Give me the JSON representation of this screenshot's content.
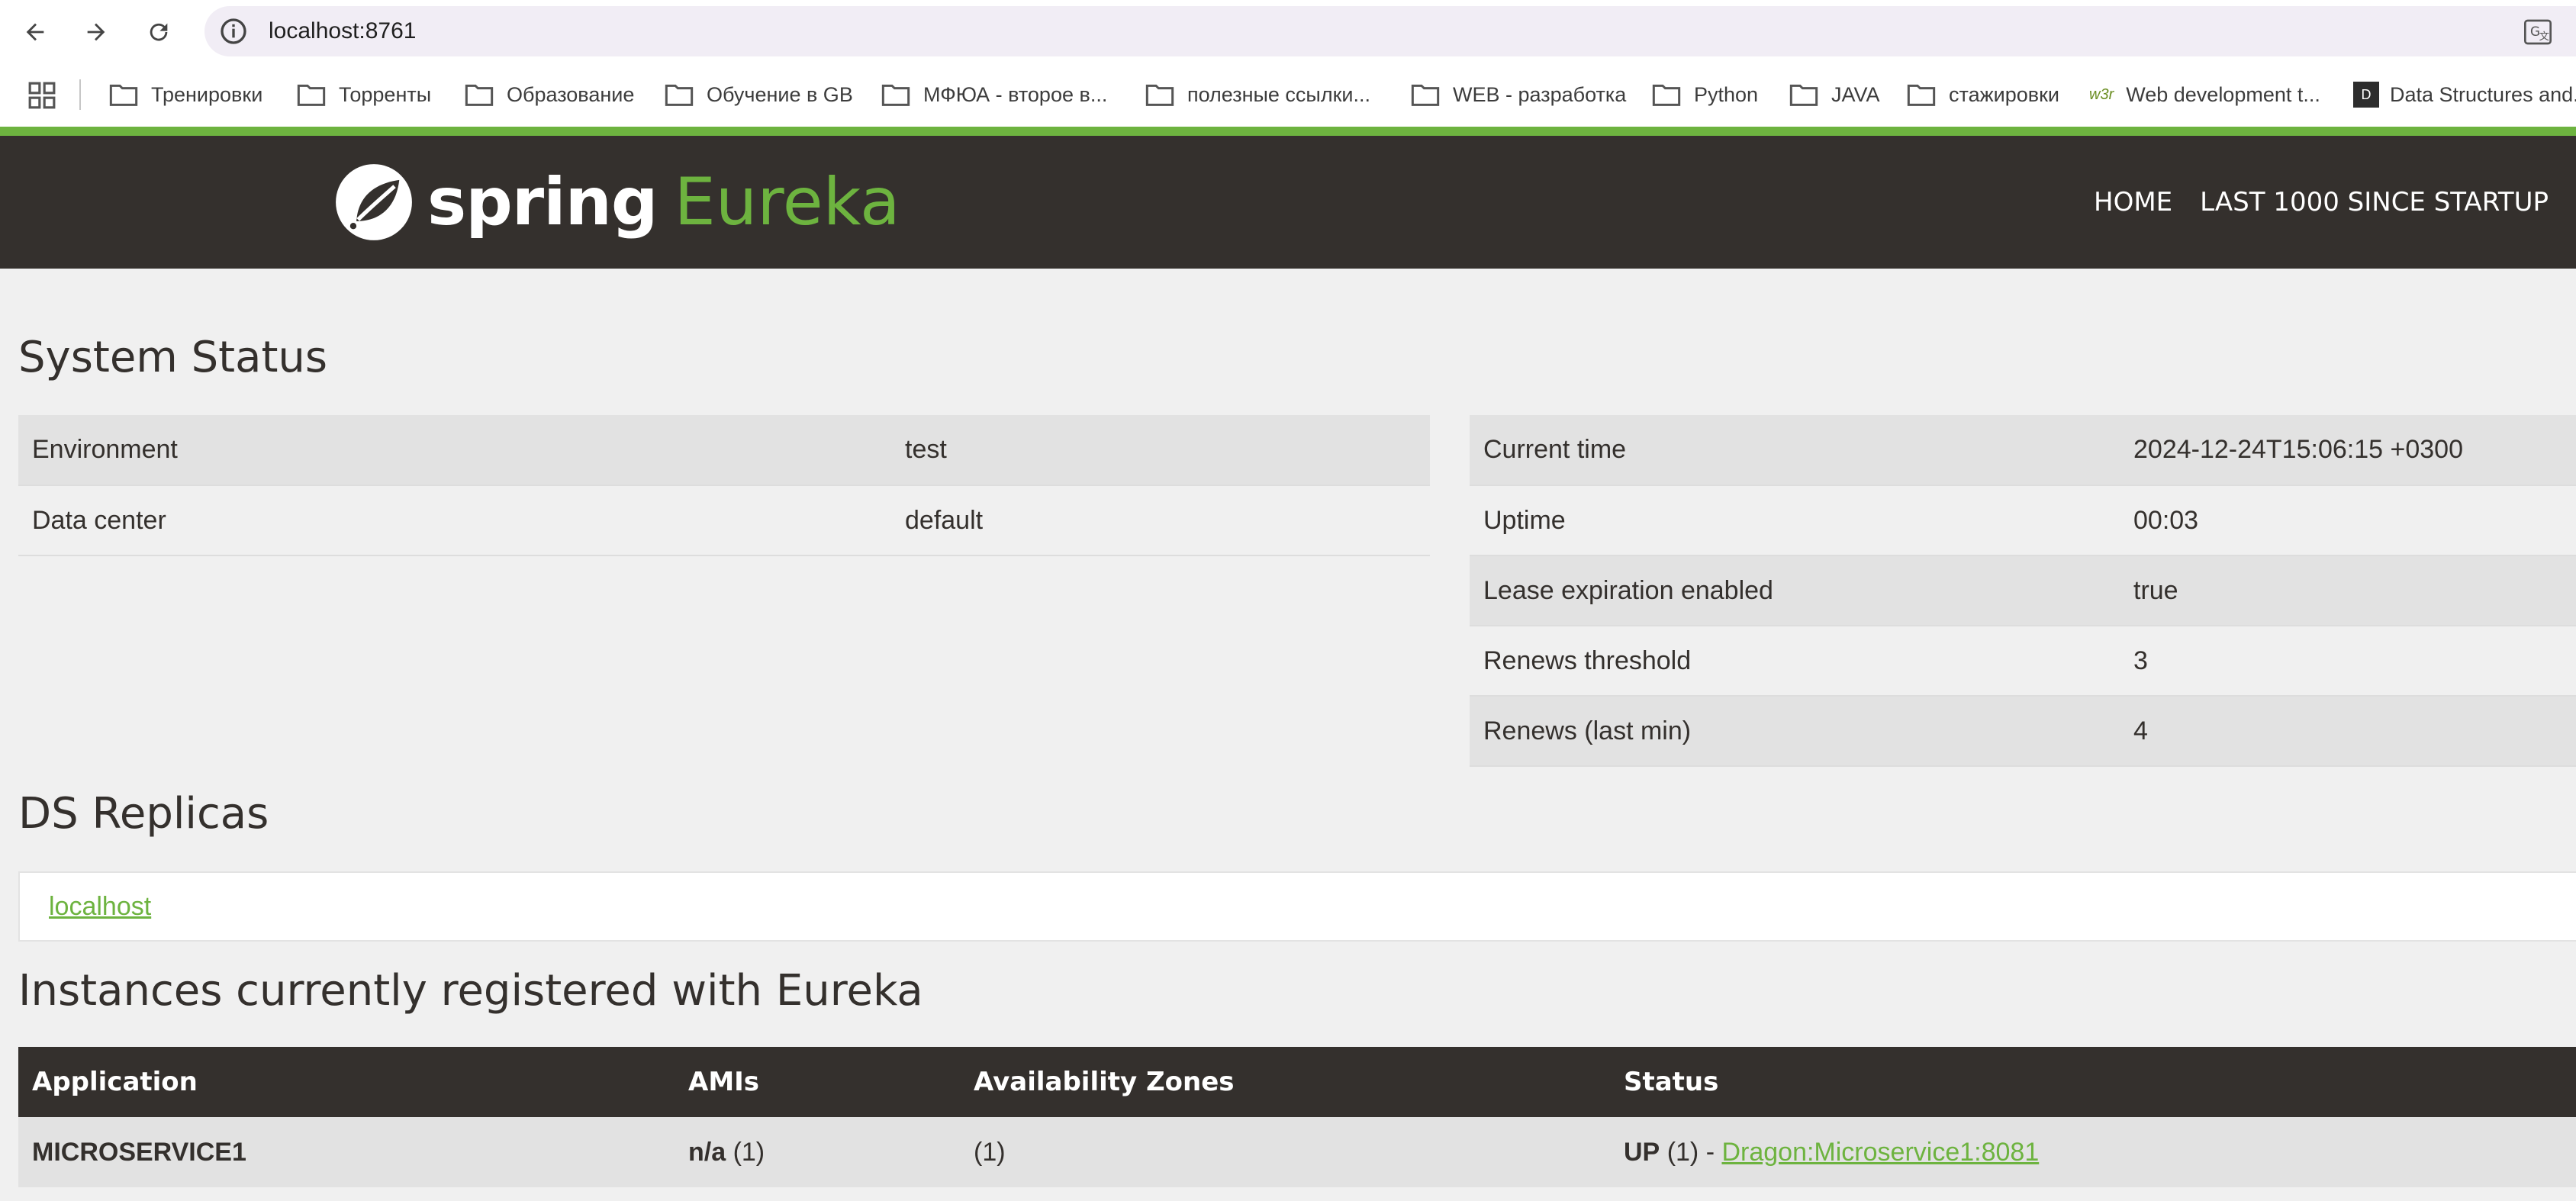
{
  "browser": {
    "url": "localhost:8761",
    "bookmarks": [
      "Тренировки",
      "Торренты",
      "Образование",
      "Обучение в GB",
      "МФЮА - второе в...",
      "полезные ссылки...",
      "WEB - разработка",
      "Python",
      "JAVA",
      "стажировки",
      "Web development t...",
      "Data Structures and..."
    ],
    "w3_badge": "w3r",
    "ds_badge": "D"
  },
  "navbar": {
    "logo_spring": "spring",
    "logo_eureka": "Eureka",
    "home": "HOME",
    "last1000": "LAST 1000 SINCE STARTUP"
  },
  "system_status": {
    "title": "System Status",
    "left": [
      {
        "label": "Environment",
        "value": "test"
      },
      {
        "label": "Data center",
        "value": "default"
      }
    ],
    "right": [
      {
        "label": "Current time",
        "value": "2024-12-24T15:06:15 +0300"
      },
      {
        "label": "Uptime",
        "value": "00:03"
      },
      {
        "label": "Lease expiration enabled",
        "value": "true"
      },
      {
        "label": "Renews threshold",
        "value": "3"
      },
      {
        "label": "Renews (last min)",
        "value": "4"
      }
    ]
  },
  "ds_replicas": {
    "title": "DS Replicas",
    "link": "localhost"
  },
  "instances": {
    "title": "Instances currently registered with Eureka",
    "headers": [
      "Application",
      "AMIs",
      "Availability Zones",
      "Status"
    ],
    "rows": [
      {
        "application": "MICROSERVICE1",
        "amis_bold": "n/a",
        "amis_count": "(1)",
        "zones": "(1)",
        "status_bold": "UP",
        "status_count": "(1) -",
        "status_link": "Dragon:Microservice1:8081"
      }
    ]
  },
  "colors": {
    "brand_green": "#6db33f",
    "navbar_dark": "#34302d"
  }
}
